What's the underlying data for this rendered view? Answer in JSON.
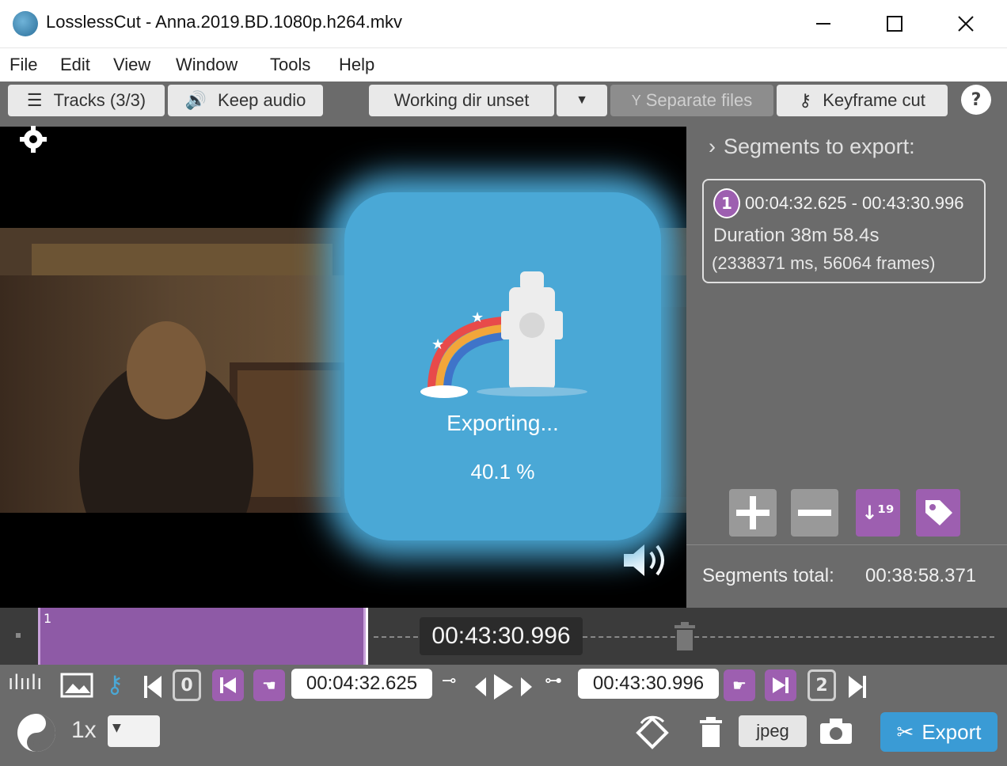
{
  "window": {
    "title": "LosslessCut - Anna.2019.BD.1080p.h264.mkv",
    "minimize_icon": "minimize-icon",
    "maximize_icon": "maximize-icon",
    "close_icon": "close-icon"
  },
  "menu": [
    "File",
    "Edit",
    "View",
    "Window",
    "Tools",
    "Help"
  ],
  "toolbar": {
    "tracks_label": "Tracks (3/3)",
    "keep_audio_label": "Keep audio",
    "working_dir_label": "Working dir unset",
    "separate_files_label": "Separate files",
    "keyframe_cut_label": "Keyframe cut",
    "help_label": "?"
  },
  "overlay": {
    "status": "Exporting...",
    "progress_text": "40.1 %",
    "progress": 0.401
  },
  "segments": {
    "header": "Segments to export:",
    "items": [
      {
        "number": "1",
        "range": "00:04:32.625 - 00:43:30.996",
        "duration": "Duration 38m 58.4s",
        "details": "(2338371 ms, 56064 frames)"
      }
    ],
    "total_label": "Segments total:",
    "total_value": "00:38:58.371"
  },
  "timeline": {
    "segment_label": "1",
    "current_time": "00:43:30.996"
  },
  "controls": {
    "start_time": "00:04:32.625",
    "end_time": "00:43:30.996",
    "start_box": "0",
    "end_box": "2",
    "speed": "1x",
    "format": "jpeg",
    "export_label": "Export"
  },
  "colors": {
    "accent": "#4aa8d6",
    "segment": "#8e5aa6",
    "purple_button": "#9d5fb0",
    "export_button": "#3a9bd5"
  }
}
